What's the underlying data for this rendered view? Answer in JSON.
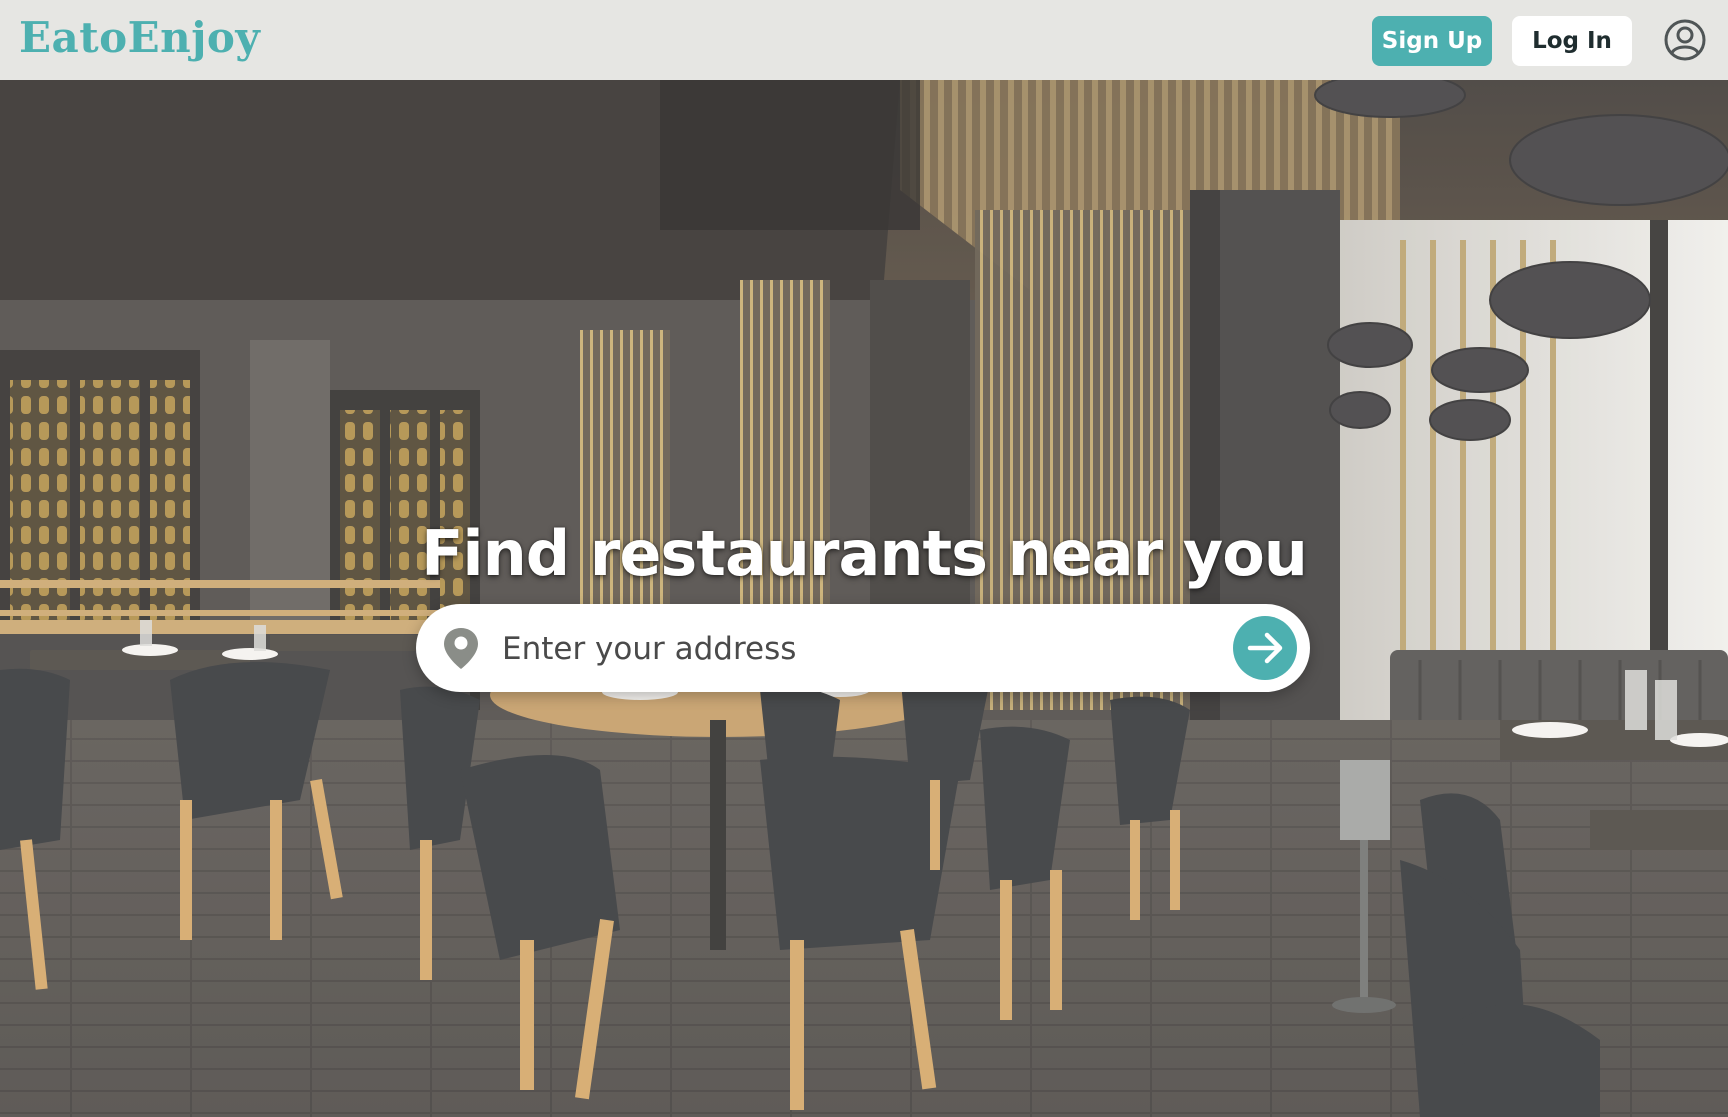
{
  "header": {
    "logo_text": "EatoEnjoy",
    "signup_label": "Sign Up",
    "login_label": "Log In",
    "user_icon": "user-circle-icon"
  },
  "hero": {
    "title": "Find restaurants near you",
    "background_image": "restaurant-interior-photo",
    "search": {
      "placeholder": "Enter your address",
      "value": "",
      "location_icon": "map-pin-icon",
      "submit_icon": "arrow-right-icon"
    }
  },
  "colors": {
    "brand_teal": "#4db0b0",
    "header_bg": "#e6e6e3",
    "text_dark": "#1f2d2f",
    "white": "#ffffff"
  }
}
